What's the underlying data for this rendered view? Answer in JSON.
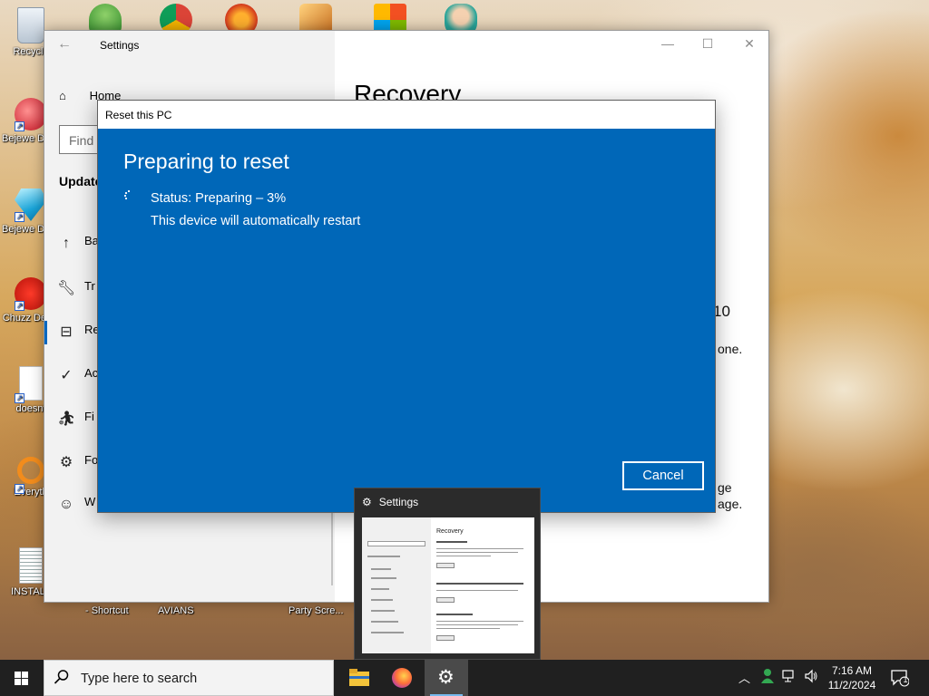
{
  "desktop_icons": [
    {
      "label": "Recycle",
      "name": "recycle-bin-icon"
    },
    {
      "label": "Bejewe Delux",
      "name": "bejeweled-icon"
    },
    {
      "label": "Bejewe Delux",
      "name": "bejeweled-diamond-icon"
    },
    {
      "label": "Chuzz Delux",
      "name": "chuzzle-icon"
    },
    {
      "label": "doesnt",
      "name": "document-icon"
    },
    {
      "label": "Everyth",
      "name": "everything-search-icon"
    },
    {
      "label": "INSTALL",
      "name": "install-text-icon"
    }
  ],
  "desktop_labels_bottom": [
    "- Shortcut",
    "AVIANS",
    "Party Scre..."
  ],
  "settings": {
    "title": "Settings",
    "home": "Home",
    "find_placeholder": "Find",
    "section": "Update",
    "nav": [
      "Ba",
      "Tr",
      "Re",
      "Ac",
      "Fi",
      "Fo",
      "W"
    ],
    "main_title": "Recovery",
    "fragments": [
      "10",
      "one.",
      "ge",
      "age."
    ]
  },
  "reset_dialog": {
    "window_title": "Reset this PC",
    "heading": "Preparing to reset",
    "status": "Status: Preparing – 3%",
    "note": "This device will automatically restart",
    "cancel_label": "Cancel"
  },
  "thumbnail": {
    "title": "Settings",
    "preview_title": "Recovery"
  },
  "taskbar": {
    "search_placeholder": "Type here to search",
    "time": "7:16 AM",
    "date": "11/2/2024",
    "notification_count": "1"
  },
  "colors": {
    "dialog_blue": "#0067b8",
    "taskbar": "#202020",
    "accent": "#76b9ed"
  }
}
